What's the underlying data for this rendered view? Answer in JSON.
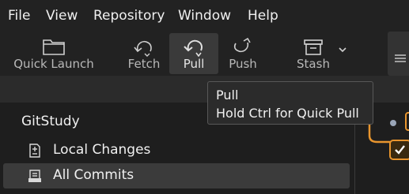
{
  "menu": {
    "file": "File",
    "view": "View",
    "repository": "Repository",
    "window": "Window",
    "help": "Help"
  },
  "toolbar": {
    "quick_launch": "Quick Launch",
    "fetch": "Fetch",
    "pull": "Pull",
    "push": "Push",
    "stash": "Stash"
  },
  "tooltip": {
    "title": "Pull",
    "hint": "Hold Ctrl for Quick Pull"
  },
  "sidebar": {
    "repo_name": "GitStudy",
    "items": [
      {
        "label": "Local Changes",
        "icon": "local-changes-icon",
        "selected": false
      },
      {
        "label": "All Commits",
        "icon": "all-commits-icon",
        "selected": true
      }
    ]
  },
  "colors": {
    "background": "#1e1e1e",
    "toolbar": "#222222",
    "selected": "#3b3b3b",
    "accent": "#e8952e"
  }
}
